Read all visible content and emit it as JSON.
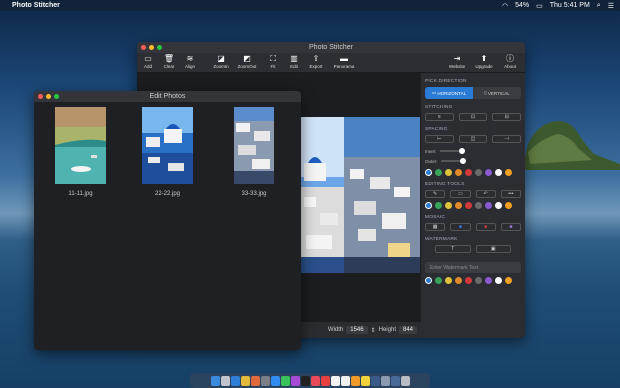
{
  "menubar": {
    "app_name": "Photo Stitcher",
    "battery": "54%",
    "clock": "Thu 5:41 PM"
  },
  "main_window": {
    "title": "Photo Stitcher",
    "toolbar": [
      {
        "label": "Add",
        "icon": "add-icon"
      },
      {
        "label": "Clear",
        "icon": "trash-icon"
      },
      {
        "label": "Align",
        "icon": "layers-icon"
      },
      {
        "label": "ZoomIn",
        "icon": "zoom-in-icon"
      },
      {
        "label": "ZoomOut",
        "icon": "zoom-out-icon"
      },
      {
        "label": "Fit",
        "icon": "fit-icon"
      },
      {
        "label": "Edit",
        "icon": "edit-icon"
      },
      {
        "label": "Export",
        "icon": "export-icon"
      },
      {
        "label": "Panorama",
        "icon": "panorama-icon"
      },
      {
        "label": "Website",
        "icon": "website-icon"
      },
      {
        "label": "Upgrade",
        "icon": "upgrade-icon"
      },
      {
        "label": "About",
        "icon": "about-icon"
      }
    ],
    "size": {
      "width_label": "Width",
      "width_value": "1546",
      "height_label": "Height",
      "height_value": "844"
    },
    "panel": {
      "pick_direction": "PICK DIRECTION",
      "horizontal": "HORIZONTAL",
      "vertical": "VERTICAL",
      "stitching": "STITCHING",
      "spacing": "SPACING",
      "inner": "Inner:",
      "outer": "Outer:",
      "editing_tools": "EDITING TOOLS",
      "mosaic": "MOSAIC",
      "watermark": "WATERMARK",
      "watermark_placeholder": "Enter Watermark Text"
    },
    "swatch_colors": [
      "#2a7bd6",
      "#3aa35a",
      "#e0c23a",
      "#e08a2a",
      "#d23a3a",
      "#6a6a6a",
      "#8a5ad0",
      "#ffffff",
      "#f0a020"
    ]
  },
  "edit_window": {
    "title": "Edit Photos",
    "photos": [
      {
        "name": "11-11.jpg"
      },
      {
        "name": "22-22.jpg"
      },
      {
        "name": "33-33.jpg"
      }
    ]
  }
}
